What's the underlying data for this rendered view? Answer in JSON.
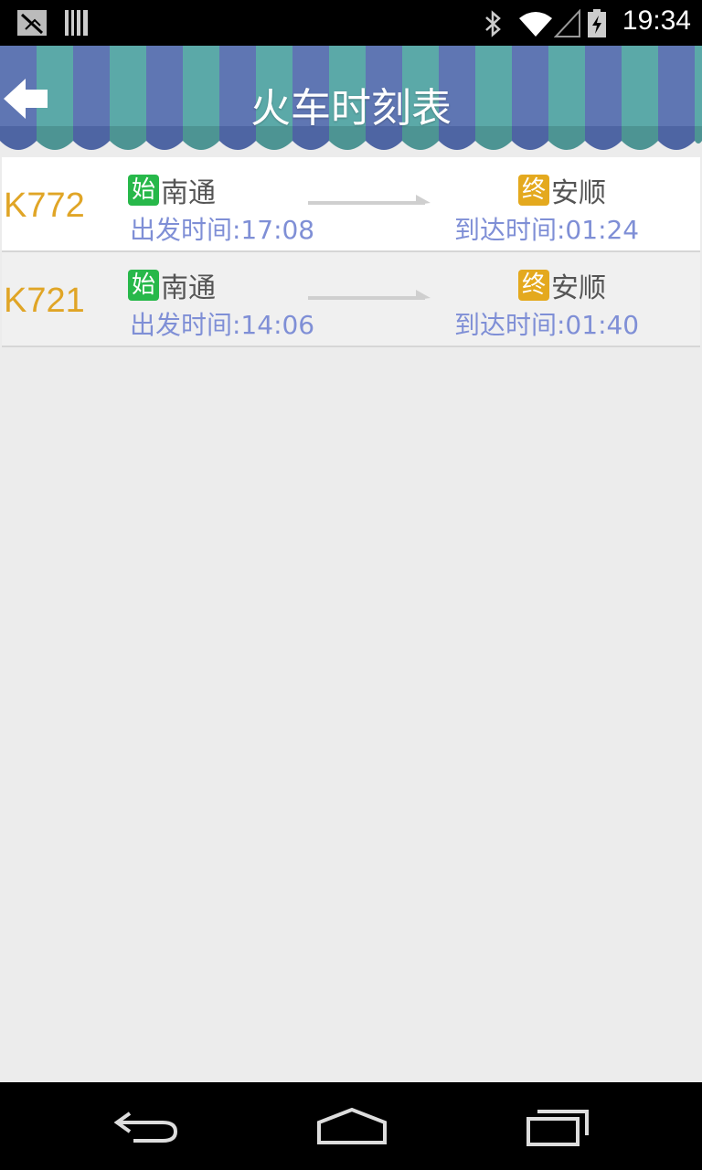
{
  "status_bar": {
    "time": "19:34",
    "icons": [
      "no-signal-icon",
      "barcode-icon",
      "bluetooth-icon",
      "wifi-icon",
      "cell-signal-icon",
      "battery-charging-icon"
    ]
  },
  "header": {
    "title": "火车时刻表",
    "back_icon": "back-arrow-icon"
  },
  "trains": [
    {
      "number": "K772",
      "start_badge": "始",
      "from": "南通",
      "departure": "出发时间:17:08",
      "end_badge": "终",
      "to": "安顺",
      "arrival": "到达时间:01:24"
    },
    {
      "number": "K721",
      "start_badge": "始",
      "from": "南通",
      "departure": "出发时间:14:06",
      "end_badge": "终",
      "to": "安顺",
      "arrival": "到达时间:01:40"
    }
  ],
  "nav_bar": {
    "icons": [
      "back-nav-icon",
      "home-nav-icon",
      "recents-nav-icon"
    ]
  },
  "colors": {
    "train_number": "#e0a526",
    "time_text": "#7f8fd6",
    "start_badge": "#27b84a",
    "end_badge": "#e4a91e",
    "awning_blue": "#5f76b3",
    "awning_teal": "#5ba9a8"
  }
}
